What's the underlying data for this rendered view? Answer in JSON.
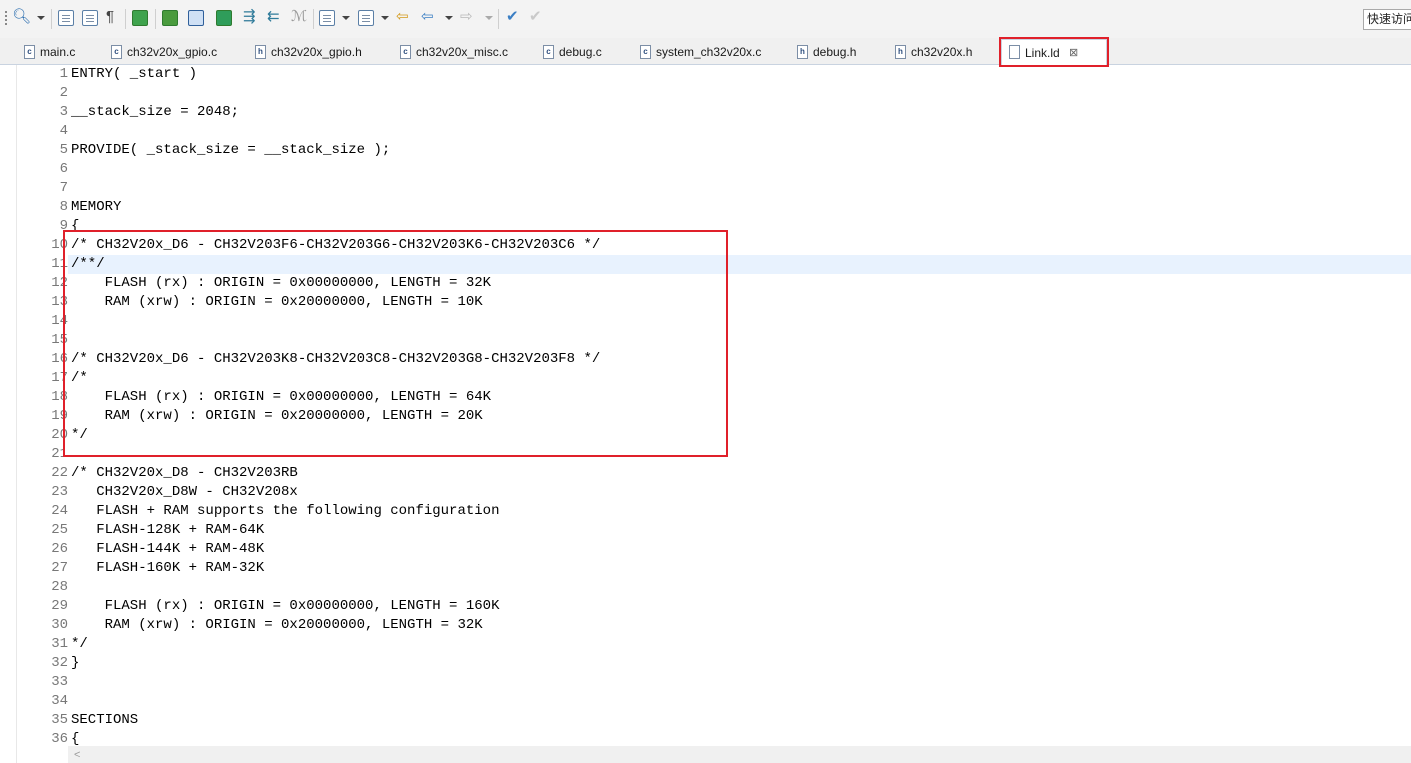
{
  "toolbar": {
    "quick_access": "快速访问"
  },
  "tabs": [
    {
      "label": "main.c",
      "kind": "c"
    },
    {
      "label": "ch32v20x_gpio.c",
      "kind": "c"
    },
    {
      "label": "ch32v20x_gpio.h",
      "kind": "h"
    },
    {
      "label": "ch32v20x_misc.c",
      "kind": "c"
    },
    {
      "label": "debug.c",
      "kind": "c"
    },
    {
      "label": "system_ch32v20x.c",
      "kind": "c"
    },
    {
      "label": "debug.h",
      "kind": "h"
    },
    {
      "label": "ch32v20x.h",
      "kind": "h"
    },
    {
      "label": "Link.ld",
      "kind": "ld",
      "active": true
    }
  ],
  "tab_close_glyph": "⊠",
  "editor": {
    "lines": [
      {
        "n": "1",
        "text": "ENTRY( _start )"
      },
      {
        "n": "2",
        "text": ""
      },
      {
        "n": "3",
        "text": "__stack_size = 2048;"
      },
      {
        "n": "4",
        "text": ""
      },
      {
        "n": "5",
        "text": "PROVIDE( _stack_size = __stack_size );"
      },
      {
        "n": "6",
        "text": ""
      },
      {
        "n": "7",
        "text": ""
      },
      {
        "n": "8",
        "text": "MEMORY"
      },
      {
        "n": "9",
        "text": "{"
      },
      {
        "n": "10",
        "text": "/* CH32V20x_D6 - CH32V203F6-CH32V203G6-CH32V203K6-CH32V203C6 */"
      },
      {
        "n": "11",
        "text": "/**/"
      },
      {
        "n": "12",
        "text": "    FLASH (rx) : ORIGIN = 0x00000000, LENGTH = 32K"
      },
      {
        "n": "13",
        "text": "    RAM (xrw) : ORIGIN = 0x20000000, LENGTH = 10K"
      },
      {
        "n": "14",
        "text": ""
      },
      {
        "n": "15",
        "text": ""
      },
      {
        "n": "16",
        "text": "/* CH32V20x_D6 - CH32V203K8-CH32V203C8-CH32V203G8-CH32V203F8 */"
      },
      {
        "n": "17",
        "text": "/*"
      },
      {
        "n": "18",
        "text": "    FLASH (rx) : ORIGIN = 0x00000000, LENGTH = 64K"
      },
      {
        "n": "19",
        "text": "    RAM (xrw) : ORIGIN = 0x20000000, LENGTH = 20K"
      },
      {
        "n": "20",
        "text": "*/"
      },
      {
        "n": "21",
        "text": ""
      },
      {
        "n": "22",
        "text": "/* CH32V20x_D8 - CH32V203RB"
      },
      {
        "n": "23",
        "text": "   CH32V20x_D8W - CH32V208x"
      },
      {
        "n": "24",
        "text": "   FLASH + RAM supports the following configuration"
      },
      {
        "n": "25",
        "text": "   FLASH-128K + RAM-64K"
      },
      {
        "n": "26",
        "text": "   FLASH-144K + RAM-48K"
      },
      {
        "n": "27",
        "text": "   FLASH-160K + RAM-32K"
      },
      {
        "n": "28",
        "text": ""
      },
      {
        "n": "29",
        "text": "    FLASH (rx) : ORIGIN = 0x00000000, LENGTH = 160K"
      },
      {
        "n": "30",
        "text": "    RAM (xrw) : ORIGIN = 0x20000000, LENGTH = 32K"
      },
      {
        "n": "31",
        "text": "*/"
      },
      {
        "n": "32",
        "text": "}"
      },
      {
        "n": "33",
        "text": ""
      },
      {
        "n": "34",
        "text": ""
      },
      {
        "n": "35",
        "text": "SECTIONS"
      },
      {
        "n": "36",
        "text": "{"
      }
    ]
  },
  "scroll_left_glyph": "<"
}
